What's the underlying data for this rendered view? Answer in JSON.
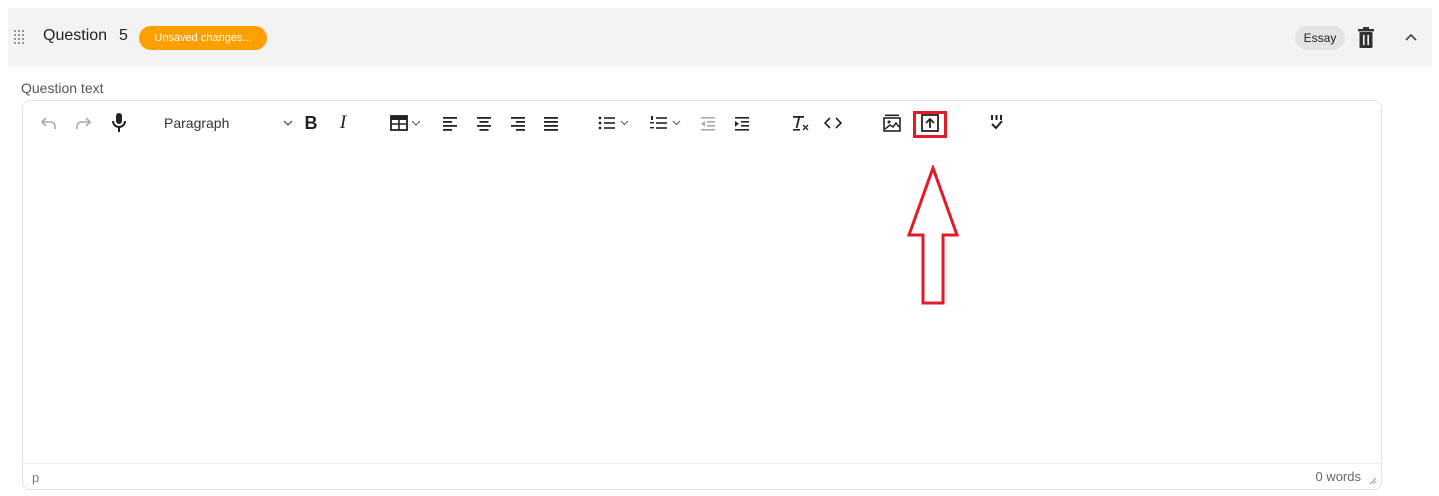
{
  "question": {
    "label": "Question",
    "number": "5",
    "status_badge": "Unsaved changes...",
    "type": "Essay"
  },
  "editor": {
    "field_label": "Question text",
    "block_format": "Paragraph",
    "element_path": "p",
    "word_count": "0 words",
    "icons": [
      "undo-icon",
      "redo-icon",
      "microphone-icon",
      "table-icon",
      "align-left-icon",
      "align-center-icon",
      "align-right-icon",
      "align-justify-icon",
      "bullet-list-icon",
      "numbered-list-icon",
      "outdent-icon",
      "indent-icon",
      "clear-formatting-icon",
      "source-code-icon",
      "media-icon",
      "upload-image-icon",
      "spellcheck-icon"
    ],
    "bold_label": "B",
    "italic_label": "I"
  },
  "colors": {
    "badge": "#ff9f00",
    "highlight": "#e21b2b"
  }
}
